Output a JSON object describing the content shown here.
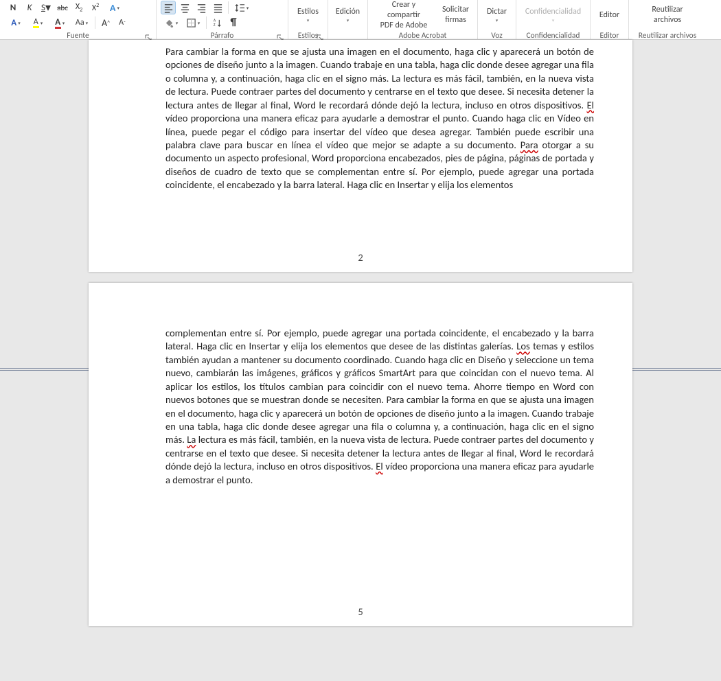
{
  "ribbon": {
    "groups": {
      "fuente": {
        "label": "Fuente"
      },
      "parrafo": {
        "label": "Párrafo"
      },
      "estilos": {
        "label": "Estilos",
        "btn": "Estilos"
      },
      "edicion": {
        "btn": "Edición"
      },
      "adobe": {
        "label": "Adobe Acrobat",
        "crear": "Crear y compartir\nPDF de Adobe",
        "firmas": "Solicitar\nfirmas"
      },
      "voz": {
        "label": "Voz",
        "btn": "Dictar"
      },
      "confidencialidad": {
        "label": "Confidencialidad",
        "btn": "Confidencialidad"
      },
      "editor": {
        "label": "Editor",
        "btn": "Editor"
      },
      "reutilizar": {
        "label": "Reutilizar archivos",
        "btn": "Reutilizar\narchivos"
      }
    },
    "font_letters": {
      "bold": "N",
      "italic": "K",
      "underline": "S",
      "strike": "abc",
      "sub": "X",
      "sup": "X",
      "case": "Aa",
      "grow": "A",
      "shrink": "A",
      "fontA": "A",
      "highlightA": "A",
      "fontcolorA": "A"
    }
  },
  "page2": {
    "text_before_el": "Para cambiar la forma en que se ajusta una imagen en el documento, haga clic y aparecerá un botón de opciones de diseño junto a la imagen. Cuando trabaje en una tabla, haga clic donde desee agregar una fila o columna y, a continuación, haga clic en el signo más. La lectura es más fácil, también, en la nueva vista de lectura. Puede contraer partes del documento y centrarse en el texto que desee. Si necesita detener la lectura antes de llegar al final, Word le recordará dónde dejó la lectura, incluso en otros dispositivos. ",
    "el": "El",
    "text_mid": " vídeo proporciona una manera eficaz para ayudarle a demostrar el punto. Cuando haga clic en Vídeo en línea, puede pegar el código para insertar del vídeo que desea agregar. También puede escribir una palabra clave para buscar en línea el vídeo que mejor se adapte a su documento. ",
    "para": "Para",
    "text_after_para": " otorgar a su documento un aspecto profesional, Word proporciona encabezados, pies de página, páginas de portada y diseños de cuadro de texto que se complementan entre sí. Por ejemplo, puede agregar una portada coincidente, el encabezado y la barra lateral. Haga clic en Insertar y elija los elementos",
    "page_number": "2"
  },
  "page5": {
    "text_top": "complementan entre sí. Por ejemplo, puede agregar una portada coincidente, el encabezado y la barra lateral. Haga clic en Insertar y elija los elementos que desee de las distintas galerías. ",
    "los": "Los",
    "text_after_los": " temas y estilos también ayudan a mantener su documento coordinado. Cuando haga clic en Diseño y seleccione un tema nuevo, cambiarán las imágenes, gráficos y gráficos SmartArt para que coincidan con el nuevo tema. Al aplicar los estilos, los títulos cambian para coincidir con el nuevo tema. Ahorre tiempo en Word con nuevos botones que se muestran donde se necesiten. Para cambiar la forma en que se ajusta una imagen en el documento, haga clic y aparecerá un botón de opciones de diseño junto a la imagen. Cuando trabaje en una tabla, haga clic donde desee agregar una fila o columna y, a continuación, haga clic en el signo más. ",
    "la": "La",
    "text_after_la": " lectura es más fácil, también, en la nueva vista de lectura. Puede contraer partes del documento y centrarse en el texto que desee. Si necesita detener la lectura antes de llegar al final, Word le recordará dónde dejó la lectura, incluso en otros dispositivos. ",
    "el": "El",
    "text_after_el": " vídeo proporciona una manera eficaz para ayudarle a demostrar el punto.",
    "page_number": "5"
  }
}
